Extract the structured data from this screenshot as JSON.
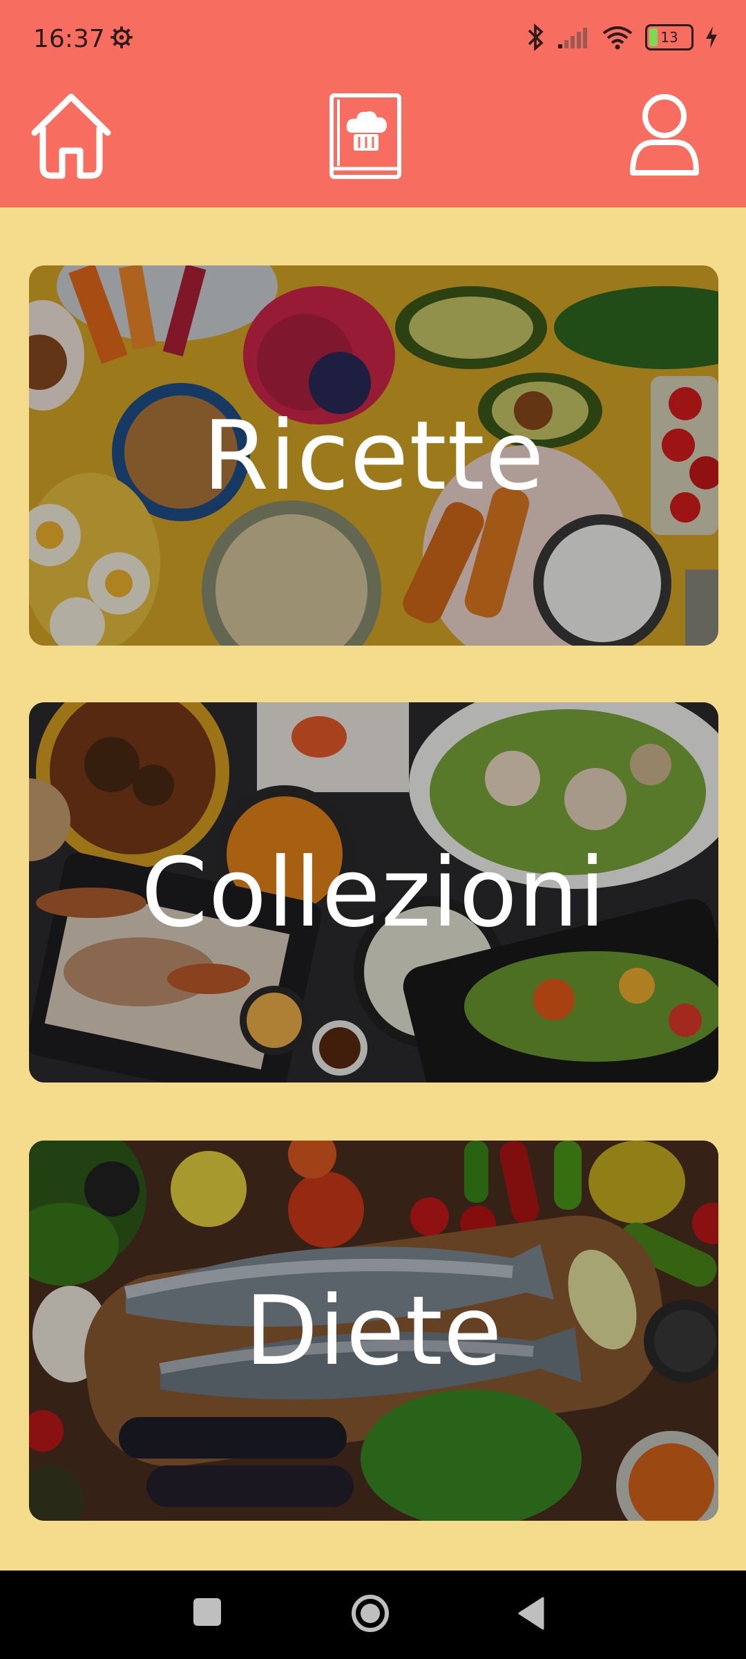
{
  "status_bar": {
    "time": "16:37",
    "battery_level": "13",
    "icons": [
      "settings-icon",
      "bluetooth-icon",
      "signal-icon",
      "wifi-icon",
      "battery-icon",
      "charging-icon"
    ]
  },
  "app_bar": {
    "icons": [
      "home-icon",
      "recipe-book-icon",
      "profile-icon"
    ]
  },
  "cards": [
    {
      "title": "Ricette"
    },
    {
      "title": "Collezioni"
    },
    {
      "title": "Diete"
    }
  ],
  "colors": {
    "header": "#f76d60",
    "background": "#f5dc8c",
    "nav_bar": "#000000"
  },
  "nav_bar": {
    "icons": [
      "recents-square-icon",
      "home-circle-icon",
      "back-triangle-icon"
    ]
  }
}
